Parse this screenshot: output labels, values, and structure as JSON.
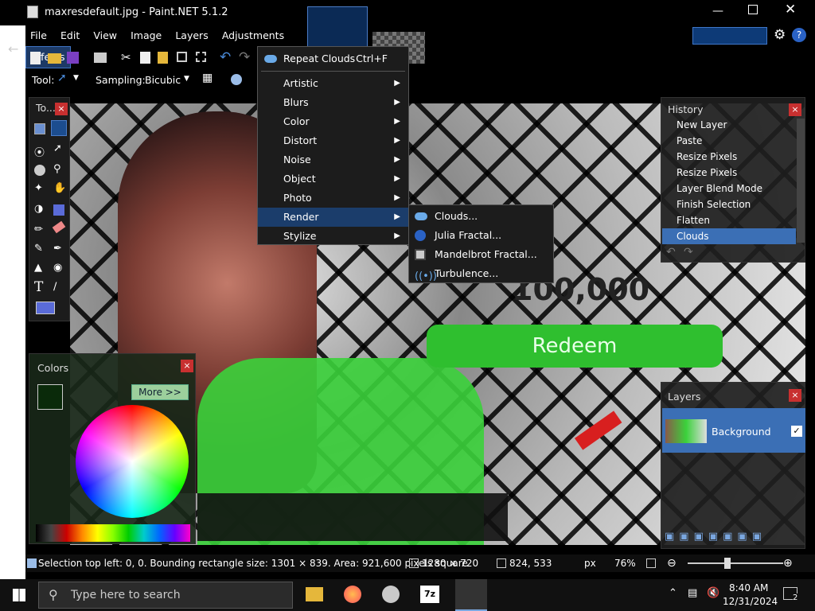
{
  "window": {
    "title": "maxresdefault.jpg - Paint.NET 5.1.2"
  },
  "menu": [
    "File",
    "Edit",
    "View",
    "Image",
    "Layers",
    "Adjustments",
    "Effects"
  ],
  "toolrow": {
    "tool_label": "Tool:",
    "sampling_label": "Sampling:",
    "sampling_value": "Bicubic"
  },
  "effects_menu": {
    "repeat_label": "Repeat Clouds",
    "repeat_shortcut": "Ctrl+F",
    "items": [
      "Artistic",
      "Blurs",
      "Color",
      "Distort",
      "Noise",
      "Object",
      "Photo",
      "Render",
      "Stylize"
    ]
  },
  "render_submenu": [
    "Clouds...",
    "Julia Fractal...",
    "Mandelbrot Fractal...",
    "Turbulence..."
  ],
  "tools_panel": {
    "title": "To..."
  },
  "history_panel": {
    "title": "History",
    "items": [
      "New Layer",
      "Paste",
      "Resize Pixels",
      "Resize Pixels",
      "Layer Blend Mode",
      "Finish Selection",
      "Flatten",
      "Clouds"
    ]
  },
  "colors_panel": {
    "title": "Colors",
    "more_label": "More >>"
  },
  "layers_panel": {
    "title": "Layers",
    "layer_name": "Background"
  },
  "canvas_text": {
    "amount": "100,000",
    "button": "Redeem"
  },
  "status": {
    "selection": "Selection top left: 0, 0. Bounding rectangle size: 1301 × 839. Area: 921,600 pixels square",
    "image_size": "1280 × 720",
    "cursor": "824, 533",
    "unit": "px",
    "zoom": "76%"
  },
  "taskbar": {
    "search_placeholder": "Type here to search",
    "time": "8:40 AM",
    "date": "12/31/2024",
    "notif_count": "2"
  },
  "colors": {
    "accent": "#1b3d6b",
    "close": "#c83030",
    "green": "#3bd13b"
  }
}
